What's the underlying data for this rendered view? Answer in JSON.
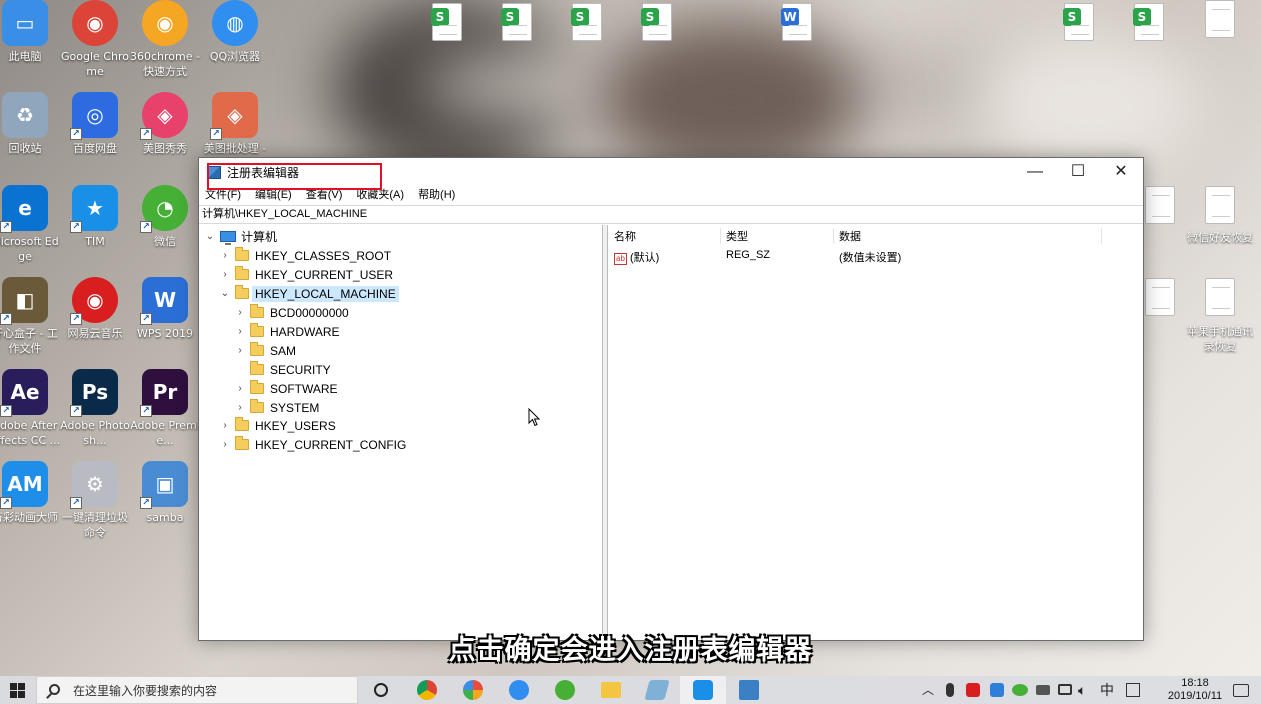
{
  "desktop": {
    "icons": [
      {
        "label": "此电脑",
        "color": "#3a8ee6"
      },
      {
        "label": "Google Chrome",
        "color": "#db4437"
      },
      {
        "label": "360chrome - 快速方式",
        "color": "#f5a623"
      },
      {
        "label": "QQ浏览器",
        "color": "#2f8ef0"
      },
      {
        "label": "回收站",
        "color": "#8fa6bd"
      },
      {
        "label": "百度网盘",
        "color": "#2c6be0"
      },
      {
        "label": "美图秀秀",
        "color": "#e8416c"
      },
      {
        "label": "美图批处理 -",
        "color": "#e06a4a"
      },
      {
        "label": "Microsoft Edge",
        "color": "#0a73d1"
      },
      {
        "label": "TIM",
        "color": "#1a8fe8"
      },
      {
        "label": "微信",
        "color": "#45b035"
      },
      {
        "label": "开心盒子 - 工作文件",
        "color": "#6a5a3a"
      },
      {
        "label": "网易云音乐",
        "color": "#d81e1e"
      },
      {
        "label": "WPS 2019",
        "color": "#2b6fd6"
      },
      {
        "label": "Adobe After Effects CC ...",
        "color": "#2a1d5c"
      },
      {
        "label": "Adobe Photosh...",
        "color": "#0a2a4a"
      },
      {
        "label": "Adobe Premie...",
        "color": "#2e0f3d"
      },
      {
        "label": "万彩动画大师",
        "color": "#1e8ee8"
      },
      {
        "label": "一键清理垃圾命令",
        "color": "#b8bcc2"
      },
      {
        "label": "samba",
        "color": "#4a8cd4"
      }
    ],
    "right_files": [
      {
        "label": "微信好友恢复"
      },
      {
        "label": "苹果手机通讯录恢复"
      }
    ]
  },
  "window": {
    "title": "注册表编辑器",
    "menu": [
      "文件(F)",
      "编辑(E)",
      "查看(V)",
      "收藏夹(A)",
      "帮助(H)"
    ],
    "address": "计算机\\HKEY_LOCAL_MACHINE",
    "controls": {
      "minimize": "—",
      "maximize": "☐",
      "close": "✕"
    },
    "tree": {
      "root": "计算机",
      "hives": [
        "HKEY_CLASSES_ROOT",
        "HKEY_CURRENT_USER",
        "HKEY_LOCAL_MACHINE",
        "HKEY_USERS",
        "HKEY_CURRENT_CONFIG"
      ],
      "selected": "HKEY_LOCAL_MACHINE",
      "children": [
        "BCD00000000",
        "HARDWARE",
        "SAM",
        "SECURITY",
        "SOFTWARE",
        "SYSTEM"
      ]
    },
    "list": {
      "columns": [
        "名称",
        "类型",
        "数据"
      ],
      "rows": [
        {
          "name": "(默认)",
          "type": "REG_SZ",
          "data": "(数值未设置)"
        }
      ]
    }
  },
  "caption": "点击确定会进入注册表编辑器",
  "taskbar": {
    "search_placeholder": "在这里输入你要搜索的内容",
    "ime": "中",
    "time": "18:18",
    "date": "2019/10/11"
  }
}
